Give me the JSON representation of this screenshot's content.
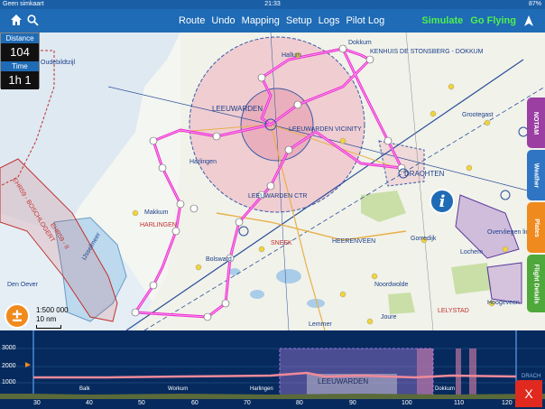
{
  "status_bar": {
    "carrier": "Geen simkaart",
    "time": "21:33",
    "battery": "87%"
  },
  "nav": {
    "menu": [
      "Route",
      "Undo",
      "Mapping",
      "Setup",
      "Logs",
      "Pilot Log"
    ],
    "actions": {
      "simulate": "Simulate",
      "go_flying": "Go Flying"
    },
    "icons": {
      "home": "home-icon",
      "search": "search-icon",
      "navigation": "location-arrow-icon"
    }
  },
  "info_panel": {
    "distance_label": "Distance",
    "distance_value": "104",
    "time_label": "Time",
    "time_value": "1h 1"
  },
  "side_tabs": [
    {
      "label": "NOTAM",
      "color": "#9b3fa3"
    },
    {
      "label": "Weather",
      "color": "#2f75c4"
    },
    {
      "label": "Plates",
      "color": "#ef8a1e"
    },
    {
      "label": "Flight Details",
      "color": "#4fa83b"
    }
  ],
  "scale": {
    "ratio": "1:500 000",
    "distance": "10 nm"
  },
  "zoom_button": {
    "symbol": "±"
  },
  "info_button": {
    "symbol": "i"
  },
  "map_labels": {
    "hallum": "Hallum",
    "leeuwarden_ctr": "LEEUWARDEN",
    "leeuwarden_vicinity": "LEEUWARDEN VICINITY",
    "leeuwarden_ctr2": "LEEUWARDEN CTR",
    "drachten": "DRACHTEN",
    "heerenveen": "HEERENVEEN",
    "bolsward": "Bolsward",
    "makkum": "Makkum",
    "sneek": "SNEEK",
    "joure": "Joure",
    "harlingen": "HARLINGEN",
    "harlingen_vlieland": "Harlingen",
    "den_oever": "Den Oever",
    "ehr59": "EHR59 - BOSCHLOGERT",
    "ehr59_ii": "EHR59 - II",
    "dokkum": "Dokkum",
    "kenhuis": "KENHUIS DE STONSBERG - DOKKUM",
    "grootegast": "Grootegast",
    "oudebildtzijl": "Oudebildtzijl",
    "gorredijk": "Gorredijk",
    "noordwolde": "Noordwolde",
    "overvlieg": "Overvliegen limited",
    "lochem": "Lochem",
    "hoogeveen": "Hoogeveen",
    "lelystad": "LELYSTAD",
    "lemmer": "Lemmer",
    "iJsselmeer": "IJsselmeer"
  },
  "profile": {
    "altitudes": [
      "3000",
      "2000",
      "1000"
    ],
    "distances": [
      "30",
      "40",
      "50",
      "60",
      "70",
      "80",
      "90",
      "100",
      "110",
      "120"
    ],
    "towns": {
      "balk": "Balk",
      "workum": "Workum",
      "harlingen": "Harlingen",
      "leeuwarden": "LEEUWARDEN",
      "dokkum": "Dokkum",
      "drachten": "DRACH"
    },
    "close_symbol": "X"
  }
}
